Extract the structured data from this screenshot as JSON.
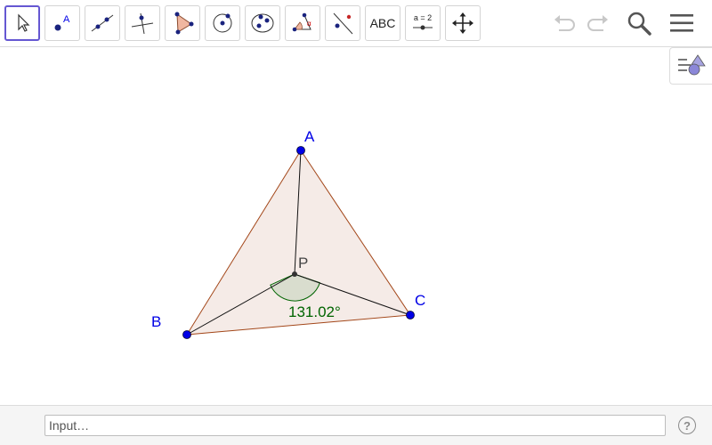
{
  "toolbar": {
    "tools": [
      {
        "name": "move",
        "icon": "cursor-arrow-icon"
      },
      {
        "name": "point",
        "icon": "point-icon",
        "label": "A"
      },
      {
        "name": "line",
        "icon": "line-through-two-points-icon"
      },
      {
        "name": "perpendicular",
        "icon": "perpendicular-line-icon"
      },
      {
        "name": "polygon",
        "icon": "polygon-icon"
      },
      {
        "name": "circle",
        "icon": "circle-center-point-icon"
      },
      {
        "name": "conic",
        "icon": "ellipse-icon"
      },
      {
        "name": "angle",
        "icon": "angle-icon"
      },
      {
        "name": "reflect",
        "icon": "reflect-about-line-icon"
      },
      {
        "name": "text",
        "icon": "text-icon",
        "label": "ABC"
      },
      {
        "name": "slider",
        "icon": "slider-icon",
        "label": "a = 2"
      },
      {
        "name": "move-graphics",
        "icon": "move-graphics-view-icon"
      }
    ],
    "undo_icon": "undo-icon",
    "redo_icon": "redo-icon",
    "search_icon": "search-icon",
    "menu_icon": "menu-icon"
  },
  "stylebar": {
    "icon": "style-bar-toggle-icon"
  },
  "construction": {
    "points": [
      {
        "label": "A"
      },
      {
        "label": "B"
      },
      {
        "label": "C"
      },
      {
        "label": "P"
      }
    ],
    "angle_label": "131.02°"
  },
  "colors": {
    "point": "#0000e6",
    "polygon_fill": "#f3e8e3",
    "polygon_edge": "#993300",
    "angle_fill": "#d6dccb",
    "angle_edge": "#006400",
    "angle_text": "#006400",
    "selected_tool": "#6557d2"
  },
  "inputbar": {
    "placeholder": "Input…",
    "help_label": "?"
  }
}
